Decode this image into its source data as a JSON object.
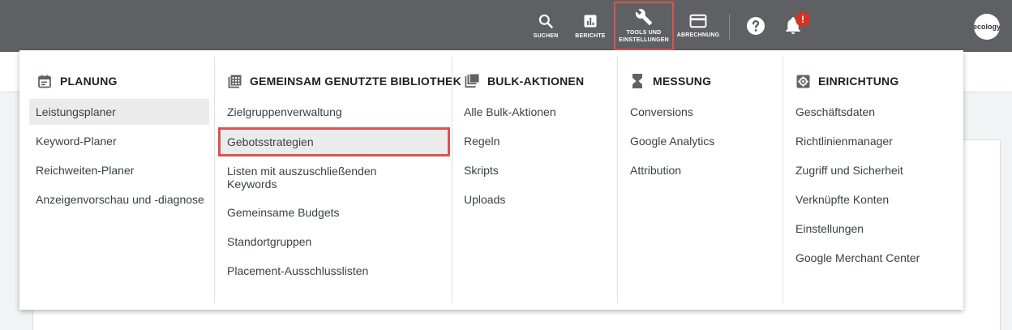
{
  "topbar": {
    "search_label": "SUCHEN",
    "search_icon": "search-icon",
    "reports_label": "BERICHTE",
    "reports_icon": "bar-chart-icon",
    "tools_label_line1": "TOOLS UND",
    "tools_label_line2": "EINSTELLUNGEN",
    "tools_icon": "wrench-icon",
    "billing_label": "ABRECHNUNG",
    "billing_icon": "credit-card-icon",
    "help_icon": "help-icon",
    "notifications_icon": "bell-icon",
    "notifications_badge": "!",
    "avatar_text": "ecology"
  },
  "colors": {
    "topbar_bg": "#5f6063",
    "highlight_border": "#d9534f",
    "badge_red": "#d93025",
    "selected_bg": "#ebebeb"
  },
  "menu": {
    "columns": [
      {
        "title": "PLANUNG",
        "icon": "calendar-icon",
        "items": [
          "Leistungsplaner",
          "Keyword-Planer",
          "Reichweiten-Planer",
          "Anzeigenvorschau und -diagnose"
        ],
        "selected": "Leistungsplaner"
      },
      {
        "title": "GEMEINSAM GENUTZTE BIBLIOTHEK",
        "icon": "library-icon",
        "items": [
          "Zielgruppenverwaltung",
          "Gebotsstrategien",
          "Listen mit auszuschließenden Keywords",
          "Gemeinsame Budgets",
          "Standortgruppen",
          "Placement-Ausschlusslisten"
        ],
        "highlighted": "Gebotsstrategien"
      },
      {
        "title": "BULK-AKTIONEN",
        "icon": "copy-icon",
        "items": [
          "Alle Bulk-Aktionen",
          "Regeln",
          "Skripts",
          "Uploads"
        ]
      },
      {
        "title": "MESSUNG",
        "icon": "hourglass-icon",
        "items": [
          "Conversions",
          "Google Analytics",
          "Attribution"
        ]
      },
      {
        "title": "EINRICHTUNG",
        "icon": "settings-icon",
        "items": [
          "Geschäftsdaten",
          "Richtlinienmanager",
          "Zugriff und Sicherheit",
          "Verknüpfte Konten",
          "Einstellungen",
          "Google Merchant Center"
        ]
      }
    ]
  }
}
